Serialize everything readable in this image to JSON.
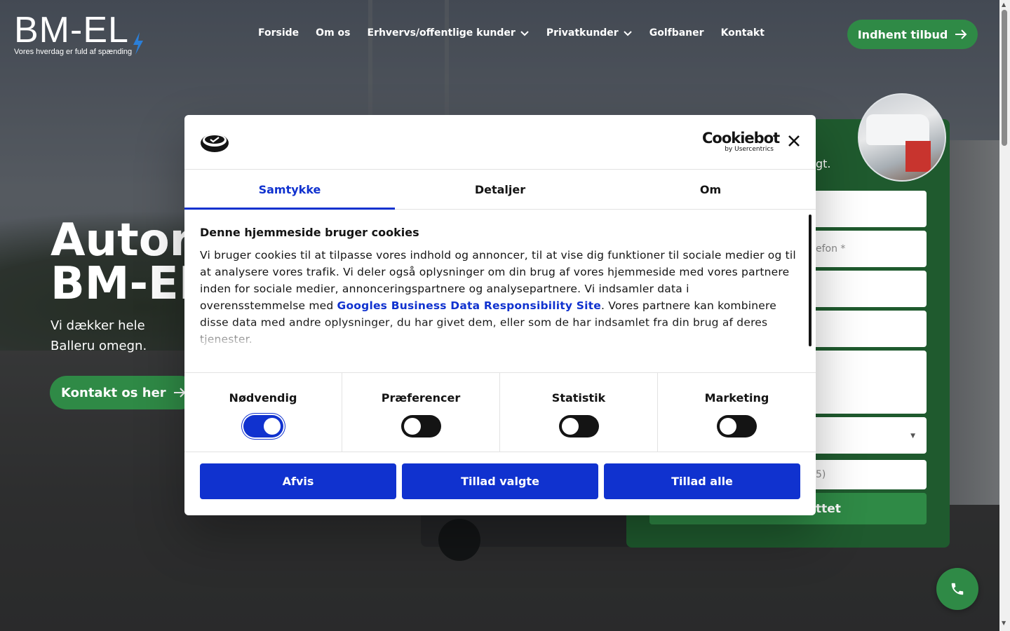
{
  "colors": {
    "brand_green": "#2f8a46",
    "panel_green": "#1f5a2e",
    "cookie_blue": "#1032cf"
  },
  "header": {
    "logo_text": "BM-EL",
    "logo_tagline": "Vores hverdag er fuld af spænding",
    "nav": [
      {
        "label": "Forside",
        "dropdown": false
      },
      {
        "label": "Om os",
        "dropdown": false
      },
      {
        "label": "Erhvervs/offentlige kunder",
        "dropdown": true
      },
      {
        "label": "Privatkunder",
        "dropdown": true
      },
      {
        "label": "Golfbaner",
        "dropdown": false
      },
      {
        "label": "Kontakt",
        "dropdown": false
      }
    ],
    "cta_label": "Indhent tilbud"
  },
  "hero": {
    "title_line1": "Autori",
    "title_line2": "BM-EL",
    "subtitle": "Vi dækker hele Balleru omegn.",
    "cta_label": "Kontakt os her"
  },
  "form": {
    "intro_fragment": "gt.",
    "fields": [
      {
        "name": "field-1",
        "placeholder": ""
      },
      {
        "name": "field-phone",
        "placeholder": "efon *"
      },
      {
        "name": "field-3",
        "placeholder": ""
      },
      {
        "name": "field-4",
        "placeholder": ""
      },
      {
        "name": "field-message",
        "placeholder": ""
      },
      {
        "name": "field-select",
        "placeholder": ""
      },
      {
        "name": "field-captcha",
        "placeholder": "5)"
      }
    ],
    "submit_fragment": "ttet"
  },
  "cookie_dialog": {
    "brand_name": "Cookiebot",
    "brand_sub": "by Usercentrics",
    "tabs": [
      {
        "label": "Samtykke",
        "active": true
      },
      {
        "label": "Detaljer",
        "active": false
      },
      {
        "label": "Om",
        "active": false
      }
    ],
    "heading": "Denne hjemmeside bruger cookies",
    "body_before_link": "Vi bruger cookies til at tilpasse vores indhold og annoncer, til at vise dig funktioner til sociale medier og til at analysere vores trafik. Vi deler også oplysninger om din brug af vores hjemmeside med vores partnere inden for sociale medier, annonceringspartnere og analysepartnere. Vi indsamler data i overensstemmelse med ",
    "link_text": "Googles Business Data Responsibility Site",
    "body_after_link": ". Vores partnere kan kombinere disse data med andre oplysninger, du har givet dem, eller som de har indsamlet fra din brug af deres tjenester.",
    "toggles": [
      {
        "label": "Nødvendig",
        "on": true
      },
      {
        "label": "Præferencer",
        "on": false
      },
      {
        "label": "Statistik",
        "on": false
      },
      {
        "label": "Marketing",
        "on": false
      }
    ],
    "buttons": {
      "reject": "Afvis",
      "allow_selected": "Tillad valgte",
      "allow_all": "Tillad alle"
    }
  }
}
